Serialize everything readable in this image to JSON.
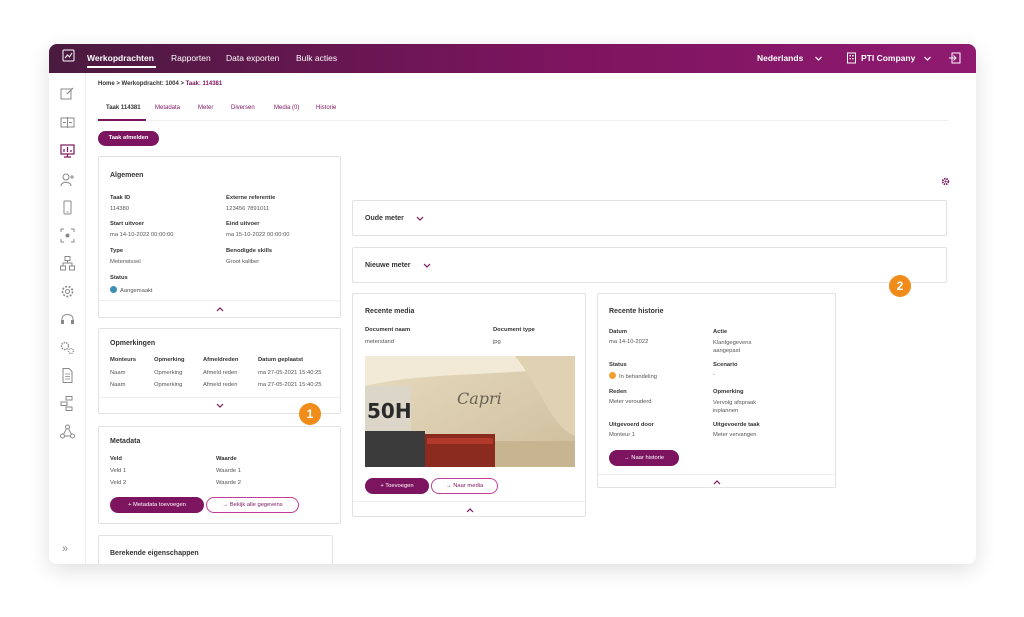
{
  "topbar": {
    "nav": [
      "Werkopdrachten",
      "Rapporten",
      "Data exporten",
      "Bulk acties"
    ],
    "language": "Nederlands",
    "company": "PTI Company"
  },
  "sidebar": {
    "icons": [
      "edit-icon",
      "split-icon",
      "chart-board-icon",
      "user-add-icon",
      "phone-icon",
      "scan-icon",
      "hierarchy-icon",
      "settings-gear-icon",
      "headset-icon",
      "gears-icon",
      "document-icon",
      "flow-icon",
      "share-icon"
    ],
    "expand": "»"
  },
  "breadcrumb": {
    "home": "Home",
    "sep": ">",
    "parent": "Werkopdracht: 1004",
    "current": "Taak: 114381"
  },
  "tabs": [
    "Taak 114381",
    "Metadata",
    "Meter",
    "Diversen",
    "Media (0)",
    "Historie"
  ],
  "buttons": {
    "taak_afmelden": "Taak afmelden",
    "metadata_toevoegen": "+ Metadata toevoegen",
    "bekijk_alle": "→ Bekijk alle gegevens",
    "toevoegen": "+ Toevoegen",
    "naar_media": "→ Naar media",
    "naar_historie": "→ Naar historie"
  },
  "algemeen": {
    "title": "Algemeen",
    "fields": [
      {
        "label": "Taak ID",
        "value": "114380"
      },
      {
        "label": "Externe referentie",
        "value": "123456 7891011"
      },
      {
        "label": "Start uitvoer",
        "value": "ma 14-10-2022 00:00:00"
      },
      {
        "label": "Eind uitvoer",
        "value": "ma 15-10-2022  00:00:00"
      },
      {
        "label": "Type",
        "value": "Meterwissel"
      },
      {
        "label": "Benodigde skills",
        "value": "Groot kaliber"
      },
      {
        "label": "Status",
        "value": "Aangemaakt"
      }
    ]
  },
  "opmerkingen": {
    "title": "Opmerkingen",
    "headers": [
      "Monteurs",
      "Opmerking",
      "Afmeldreden",
      "Datum geplaatst"
    ],
    "rows": [
      [
        "Naam",
        "Opmerking",
        "Afmeld reden",
        "ma 27-05-2021 15:40:25"
      ],
      [
        "Naam",
        "Opmerking",
        "Afmeld reden",
        "ma 27-05-2021 15:40:25"
      ]
    ]
  },
  "metadata": {
    "title": "Metadata",
    "headers": [
      "Veld",
      "Waarde"
    ],
    "rows": [
      [
        "Veld 1",
        "Waarde 1"
      ],
      [
        "Veld 2",
        "Waarde 2"
      ]
    ]
  },
  "berekende": {
    "title": "Berekende eigenschappen"
  },
  "oude_meter": {
    "title": "Oude meter"
  },
  "nieuwe_meter": {
    "title": "Nieuwe meter"
  },
  "recente_media": {
    "title": "Recente media",
    "headers": [
      "Document naam",
      "Document type"
    ],
    "row": [
      "meterstand",
      "jpg"
    ],
    "photo_text": "Capri",
    "plate_text": "50H"
  },
  "recente_historie": {
    "title": "Recente historie",
    "fields": [
      {
        "label": "Datum",
        "value": "ma 14-10-2022"
      },
      {
        "label": "Actie",
        "value": "Klantgegevens\naangepast"
      },
      {
        "label": "Status",
        "value": "In behandeling"
      },
      {
        "label": "Scenario",
        "value": "-"
      },
      {
        "label": "Reden",
        "value": "Meter verouderd"
      },
      {
        "label": "Opmerking",
        "value": "Vervolg afspraak\ninplannen"
      },
      {
        "label": "Uitgevoerd door",
        "value": "Monteur 1"
      },
      {
        "label": "Uitgevoerde taak",
        "value": "Meter vervangen"
      }
    ]
  },
  "badges": [
    "1",
    "2"
  ],
  "colors": {
    "brand": "#7d145f",
    "badge": "#f08c1a",
    "status_new": "#3a8fb7",
    "status_pending": "#f0a030"
  }
}
